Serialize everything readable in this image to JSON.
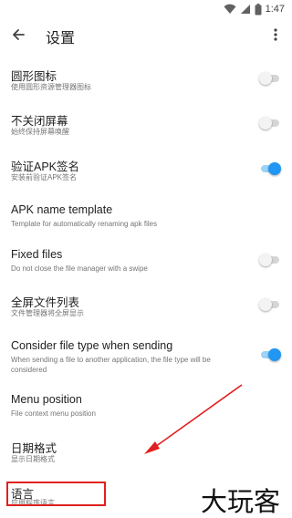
{
  "status_bar": {
    "time": "1:47",
    "icons": [
      "wifi-icon",
      "signal-icon",
      "battery-icon"
    ]
  },
  "toolbar": {
    "title": "设置",
    "back_icon": "arrow-back-icon",
    "overflow_icon": "more-vert-icon"
  },
  "settings": [
    {
      "title": "圆形图标",
      "summary": "使用圆形资源管理器图标",
      "switch": "off"
    },
    {
      "title": "不关闭屏幕",
      "summary": "始终保持屏幕唤醒",
      "switch": "off"
    },
    {
      "title": "验证APK签名",
      "summary": "安装前验证APK签名",
      "switch": "on"
    },
    {
      "title": "APK name template",
      "summary": "Template for automatically renaming apk files"
    },
    {
      "title": "Fixed files",
      "summary": "Do not close the file manager with a swipe",
      "switch": "off"
    },
    {
      "title": "全屏文件列表",
      "summary": "文件管理器将全屏显示",
      "switch": "off"
    },
    {
      "title": "Consider file type when sending",
      "summary": "When sending a file to another application, the file type will be considered",
      "switch": "on"
    },
    {
      "title": "Menu position",
      "summary": "File context menu position"
    },
    {
      "title": "日期格式",
      "summary": "显示日期格式"
    },
    {
      "title": "语言",
      "summary": "应用程序语言"
    }
  ],
  "colors": {
    "accent": "#2196f3",
    "accent_track": "#9cd3f6",
    "annotation": "#e02020"
  },
  "watermark": "大玩客"
}
